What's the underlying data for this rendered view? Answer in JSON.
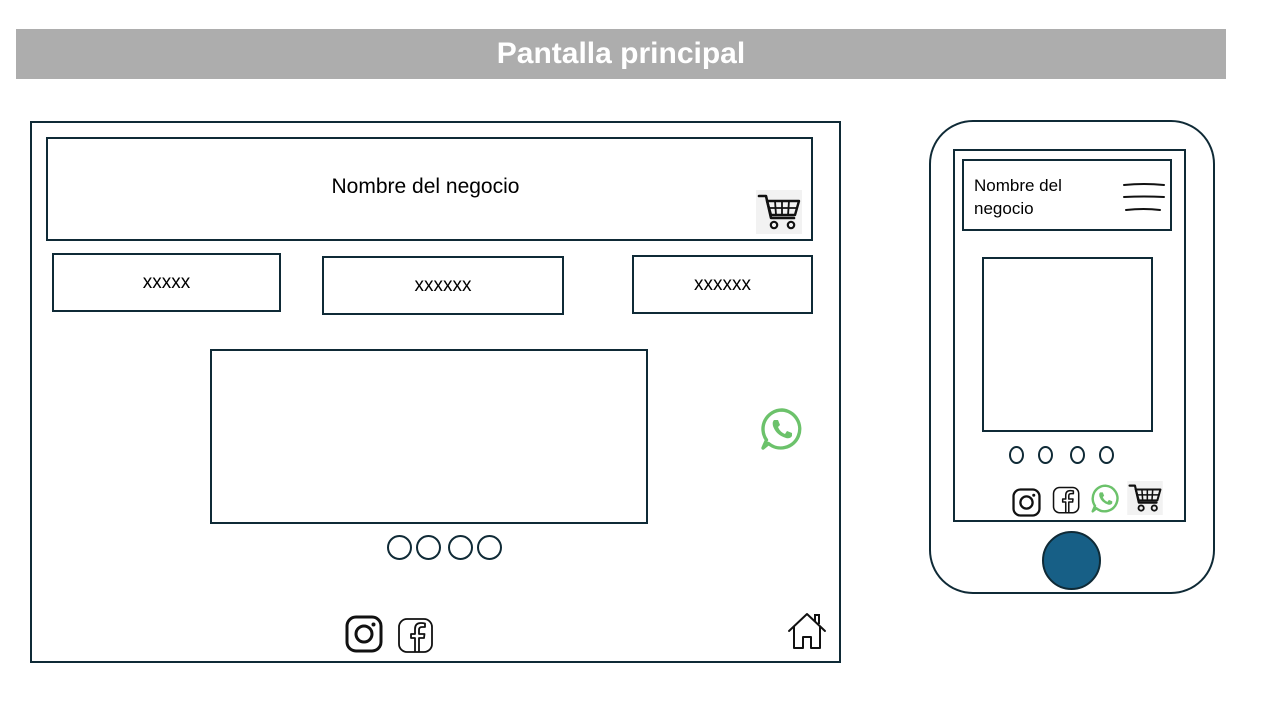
{
  "page": {
    "title": "Pantalla principal"
  },
  "desktop": {
    "business_name": "Nombre del negocio",
    "nav": [
      {
        "label": "xxxxx"
      },
      {
        "label": "xxxxxx"
      },
      {
        "label": "xxxxxx"
      }
    ],
    "carousel_dots": 4,
    "icons": {
      "cart": "shopping-cart-icon",
      "whatsapp": "whatsapp-icon",
      "instagram": "instagram-icon",
      "facebook": "facebook-icon",
      "home": "home-icon"
    }
  },
  "mobile": {
    "business_name": "Nombre del negocio",
    "carousel_dots": 4,
    "icons": {
      "menu": "hamburger-menu-icon",
      "instagram": "instagram-icon",
      "facebook": "facebook-icon",
      "whatsapp": "whatsapp-icon",
      "cart": "shopping-cart-icon"
    }
  },
  "colors": {
    "title_bar": "#adadad",
    "outline": "#0f2a36",
    "whatsapp": "#6cc26b",
    "home_button": "#175f86"
  }
}
